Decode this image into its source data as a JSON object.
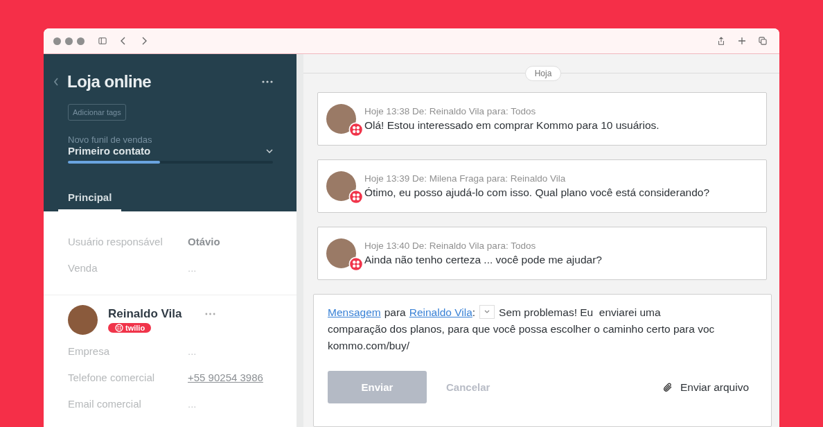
{
  "lead": {
    "title": "Loja online",
    "tags_button": "Adicionar tags",
    "pipeline": "Novo funil de vendas",
    "stage": "Primeiro contato",
    "level": 0.45,
    "tabs": [
      {
        "label": "Principal",
        "selected": true
      }
    ],
    "fields": [
      {
        "label": "Usuário responsável",
        "value": "Otávio",
        "kind": "bold"
      },
      {
        "label": "Venda",
        "value": "...",
        "kind": "plain"
      }
    ]
  },
  "contact": {
    "name": "Reinaldo Vila",
    "channel": "twilio",
    "fields": [
      {
        "label": "Empresa",
        "value": "...",
        "kind": "plain"
      },
      {
        "label": "Telefone comercial",
        "value": "+55 90254 3986",
        "kind": "link"
      },
      {
        "label": "Email comercial",
        "value": "...",
        "kind": "plain"
      }
    ]
  },
  "feed": {
    "date": "Hoja",
    "messages": [
      {
        "meta": "Hoje 13:38 De: Reinaldo Vila para: Todos",
        "text": "Olá! Estou interessado em comprar Kommo para 10 usuários."
      },
      {
        "meta": "Hoje 13:39 De: Milena Fraga para: Reinaldo Vila",
        "text": "Ótimo, eu posso ajudá-lo com isso. Qual plano você está considerando?"
      },
      {
        "meta": "Hoje 13:40 De: Reinaldo Vila para: Todos",
        "text": "Ainda não tenho certeza ... você pode me ajudar?"
      }
    ]
  },
  "composer": {
    "type_link": "Mensagem",
    "to_word": "para",
    "recipient": "Reinaldo Vila",
    "colon": ":",
    "text_lines": [
      "Sem problemas! Eu  enviarei uma",
      "comparação dos planos, para que você possa escolher o caminho certo para voc"
    ],
    "url": "kommo.com/buy/",
    "send": "Enviar",
    "cancel": "Cancelar",
    "attach": "Enviar arquivo"
  }
}
